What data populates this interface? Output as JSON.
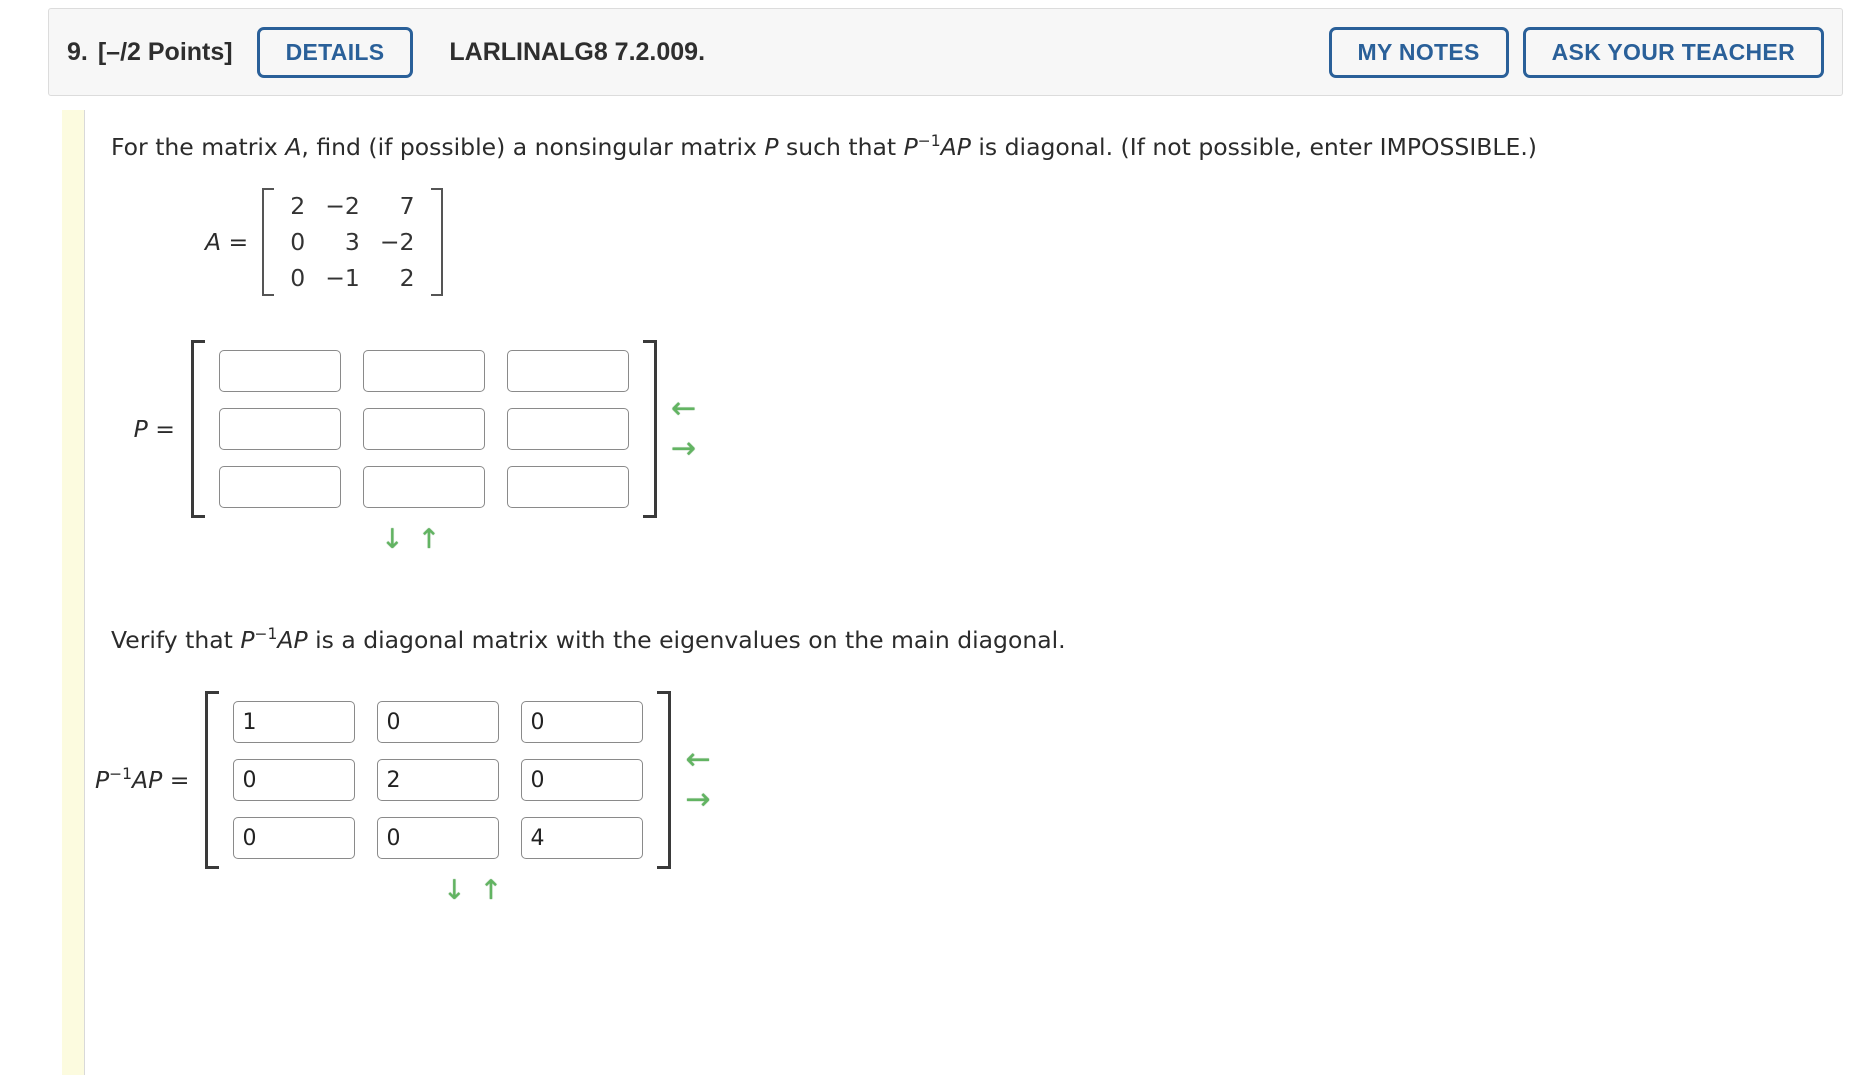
{
  "header": {
    "question_number": "9.",
    "points": "[–/2 Points]",
    "details_label": "DETAILS",
    "question_code": "LARLINALG8 7.2.009.",
    "my_notes_label": "MY NOTES",
    "ask_teacher_label": "ASK YOUR TEACHER"
  },
  "prompt": {
    "part1": "For the matrix ",
    "var_a": "A",
    "part2": ", find (if possible) a nonsingular matrix ",
    "var_p": "P",
    "part3": " such that ",
    "pinv_p": "P",
    "pinv_exp": "−1",
    "pinv_ap": "AP",
    "part4": " is diagonal. (If not possible, enter IMPOSSIBLE.)"
  },
  "matrix_a": {
    "label": "A =",
    "rows": [
      [
        "2",
        "−2",
        "7"
      ],
      [
        "0",
        "3",
        "−2"
      ],
      [
        "0",
        "−1",
        "2"
      ]
    ],
    "red_cell": {
      "row": 0,
      "col": 2
    },
    "red_color": "#cc2200"
  },
  "matrix_p": {
    "label": "P =",
    "values": [
      [
        "",
        "",
        ""
      ],
      [
        "",
        "",
        ""
      ],
      [
        "",
        "",
        ""
      ]
    ],
    "side_arrows": [
      "←",
      "→"
    ],
    "bottom_arrows": [
      "↓",
      "↑"
    ]
  },
  "verify": {
    "part1": "Verify that ",
    "pinv_p": "P",
    "pinv_exp": "−1",
    "pinv_ap": "AP",
    "part2": " is a diagonal matrix with the eigenvalues on the main diagonal."
  },
  "matrix_pap": {
    "label_p": "P",
    "label_exp": "−1",
    "label_ap": "AP =",
    "values": [
      [
        "1",
        "0",
        "0"
      ],
      [
        "0",
        "2",
        "0"
      ],
      [
        "0",
        "0",
        "4"
      ]
    ],
    "side_arrows": [
      "←",
      "→"
    ],
    "bottom_arrows": [
      "↓",
      "↑"
    ]
  },
  "colors": {
    "accent_blue": "#2a6099",
    "arrow_green": "#62b462",
    "yellow_strip": "#fcfbdf",
    "header_bg": "#f7f7f7"
  }
}
